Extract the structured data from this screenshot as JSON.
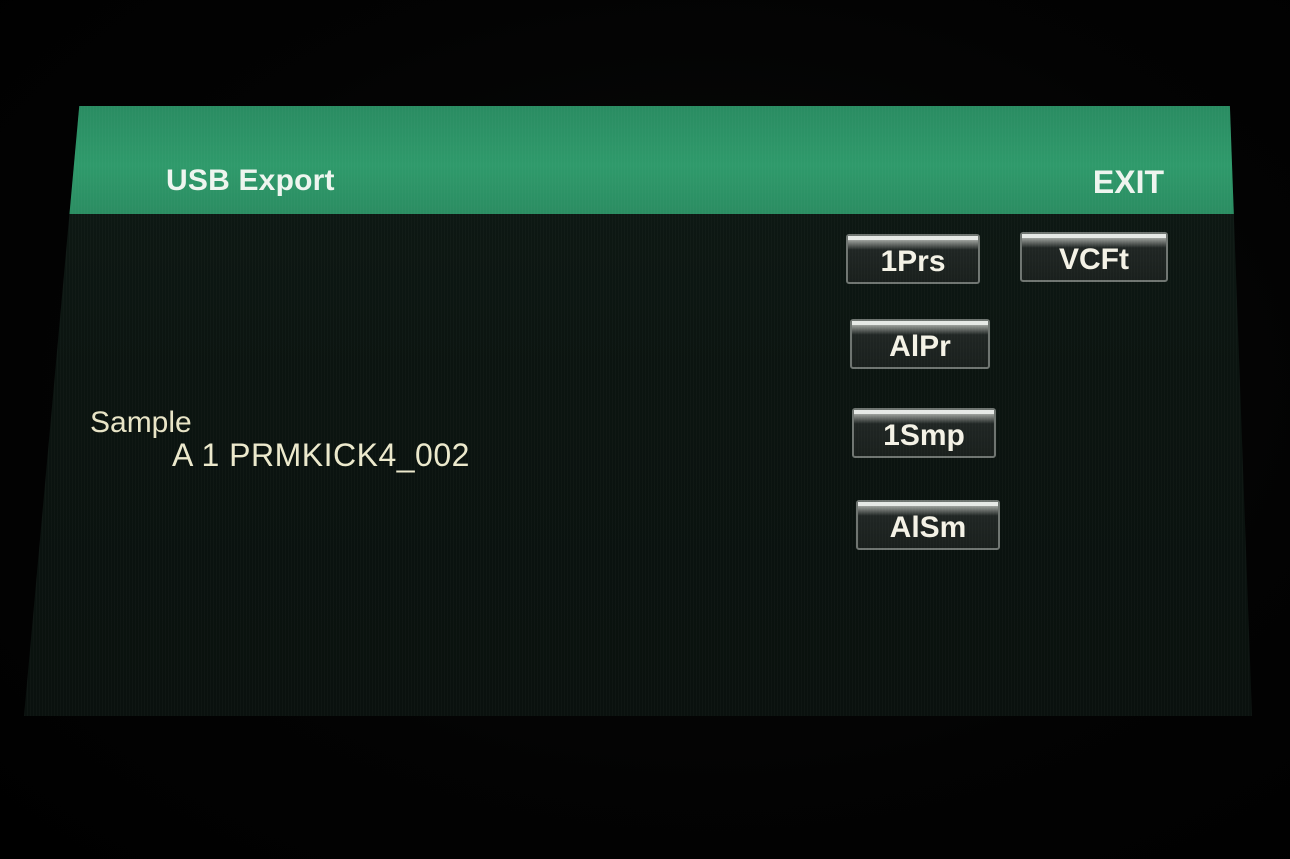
{
  "header": {
    "title": "USB Export",
    "exit_label": "EXIT"
  },
  "sample": {
    "label": "Sample",
    "value": "A  1 PRMKICK4_002"
  },
  "buttons": {
    "one_preset": "1Prs",
    "vcf_table": "VCFt",
    "all_presets": "AlPr",
    "one_sample": "1Smp",
    "all_samples": "AlSm"
  },
  "colors": {
    "header_green": "#2f9a6b",
    "screen_bg": "#0b1410",
    "text_cream": "#ece9cc"
  }
}
